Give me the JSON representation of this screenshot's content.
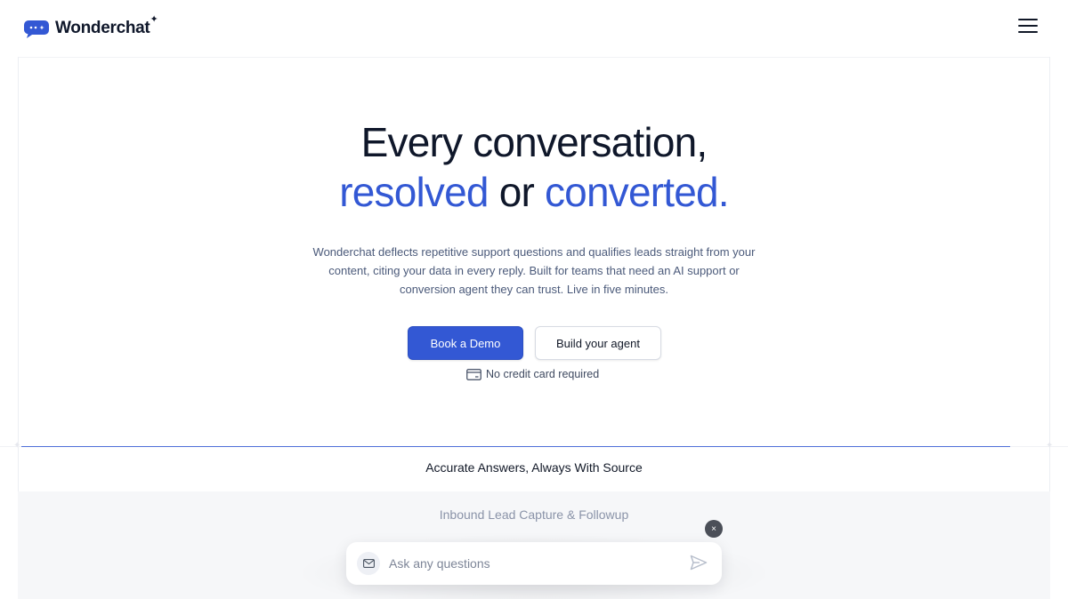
{
  "header": {
    "brand": "Wonderchat",
    "brand_mark": "✦",
    "menu_icon": "hamburger-menu-icon"
  },
  "hero": {
    "title_line1": "Every conversation,",
    "title_word1": "resolved",
    "title_connector": "or",
    "title_word2": "converted.",
    "subtitle": "Wonderchat deflects repetitive support questions and qualifies leads straight from your content, citing your data in every reply. Built for teams that need an AI support or conversion agent they can trust. Live in five minutes.",
    "primary_button": "Book a Demo",
    "secondary_button": "Build your agent",
    "note": "No credit card required"
  },
  "tabs": {
    "active": "Accurate Answers, Always With Source",
    "next": "Inbound Lead Capture & Followup"
  },
  "chat": {
    "placeholder": "Ask any questions",
    "close_label": "×"
  },
  "colors": {
    "accent": "#3358d4",
    "text": "#0f172a",
    "muted": "#4b5a7a"
  }
}
